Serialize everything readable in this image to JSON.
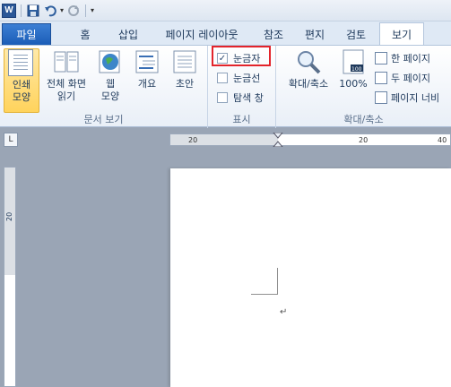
{
  "qat": {
    "app_icon": "word-icon",
    "app_letter": "W",
    "icons": [
      "save-icon",
      "undo-icon",
      "redo-icon",
      "customize-icon"
    ]
  },
  "tabs": [
    {
      "label": "파일",
      "key": "file"
    },
    {
      "label": "홈",
      "key": "home"
    },
    {
      "label": "삽입",
      "key": "insert"
    },
    {
      "label": "페이지 레이아웃",
      "key": "page-layout"
    },
    {
      "label": "참조",
      "key": "references"
    },
    {
      "label": "편지",
      "key": "mailings"
    },
    {
      "label": "검토",
      "key": "review"
    },
    {
      "label": "보기",
      "key": "view"
    }
  ],
  "ribbon": {
    "views_group": {
      "label": "문서 보기",
      "buttons": [
        {
          "label": "인쇄 모양",
          "line1": "인쇄",
          "line2": "모양",
          "selected": true
        },
        {
          "label": "전체 화면 읽기",
          "line1": "전체 화면",
          "line2": "읽기"
        },
        {
          "label": "웹 모양",
          "line1": "웹",
          "line2": "모양"
        },
        {
          "label": "개요",
          "line1": "개요",
          "line2": ""
        },
        {
          "label": "초안",
          "line1": "초안",
          "line2": ""
        }
      ]
    },
    "show_group": {
      "label": "표시",
      "ruler": {
        "label": "눈금자",
        "checked": true
      },
      "gridlines": {
        "label": "눈금선",
        "checked": false
      },
      "nav_pane": {
        "label": "탐색 창",
        "checked": false
      }
    },
    "zoom_group": {
      "label": "확대/축소",
      "zoom_button": "확대/축소",
      "hundred_button": "100%",
      "one_page": "한 페이지",
      "two_pages": "두 페이지",
      "page_width": "페이지 너비"
    }
  },
  "ruler": {
    "corner_symbol": "L",
    "h_ticks": [
      "20",
      "20",
      "40"
    ],
    "v_ticks": [
      "20"
    ]
  },
  "document": {
    "paragraph_mark": "↵"
  },
  "colors": {
    "file_tab": "#1b5db7",
    "highlight": "#e3242b",
    "selected_btn": "#ffd35c"
  }
}
